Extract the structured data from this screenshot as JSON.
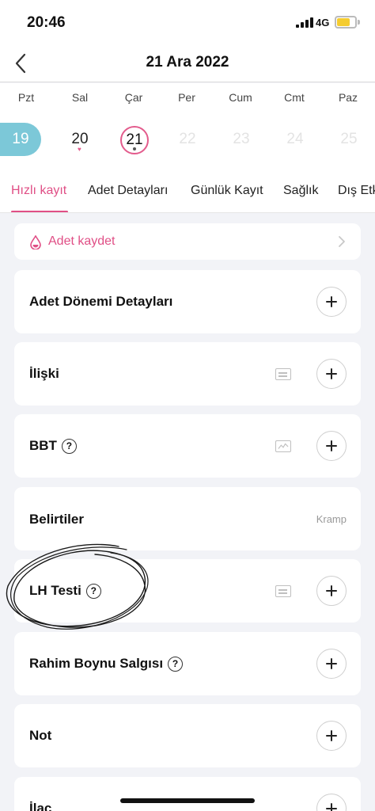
{
  "status_bar": {
    "time": "20:46",
    "network": "4G"
  },
  "nav": {
    "title": "21 Ara 2022"
  },
  "week": {
    "weekdays": [
      "Pzt",
      "Sal",
      "Çar",
      "Per",
      "Cum",
      "Cmt",
      "Paz"
    ],
    "days": [
      "19",
      "20",
      "21",
      "22",
      "23",
      "24",
      "25"
    ]
  },
  "tabs": [
    "Hızlı kayıt",
    "Adet Detayları",
    "Günlük Kayıt",
    "Sağlık",
    "Dış Etk"
  ],
  "period": {
    "label": "Adet kaydet"
  },
  "cards": {
    "adet_donemi": "Adet Dönemi Detayları",
    "iliski": "İlişki",
    "bbt": "BBT",
    "belirtiler": "Belirtiler",
    "belirtiler_value": "Kramp",
    "lh": "LH Testi",
    "rahim": "Rahim Boynu Salgısı",
    "not": "Not",
    "ilac": "İlaç"
  },
  "icons": {
    "help": "?",
    "accent_color": "#e04f86",
    "highlight_color": "#7cc8d8"
  }
}
